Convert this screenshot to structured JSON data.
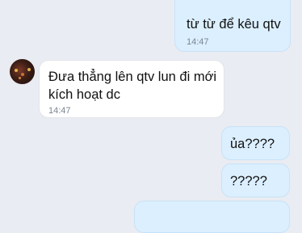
{
  "messages": [
    {
      "direction": "outgoing",
      "text": "từ từ để kêu qtv",
      "time": "14:47"
    },
    {
      "direction": "incoming",
      "text_line1": "Đưa thẳng lên qtv lun đi mới",
      "text_line2": "kích hoạt dc",
      "time": "14:47"
    },
    {
      "direction": "outgoing",
      "text": "ủa????"
    },
    {
      "direction": "outgoing",
      "text": "?????"
    }
  ]
}
